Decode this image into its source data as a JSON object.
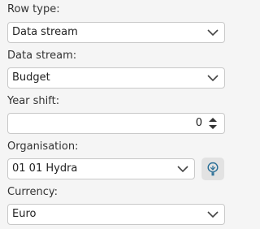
{
  "row_type": {
    "label": "Row type:",
    "value": "Data stream"
  },
  "data_stream": {
    "label": "Data stream:",
    "value": "Budget"
  },
  "year_shift": {
    "label": "Year shift:",
    "value": "0"
  },
  "organisation": {
    "label": "Organisation:",
    "value": "01 01 Hydra",
    "tree_icon": "tree-icon"
  },
  "currency": {
    "label": "Currency:",
    "value": "Euro"
  },
  "colors": {
    "background": "#f5f5f5",
    "field_border": "#c8c8c8",
    "button_background": "#e2e2e2",
    "icon_accent": "#2a6f97"
  }
}
